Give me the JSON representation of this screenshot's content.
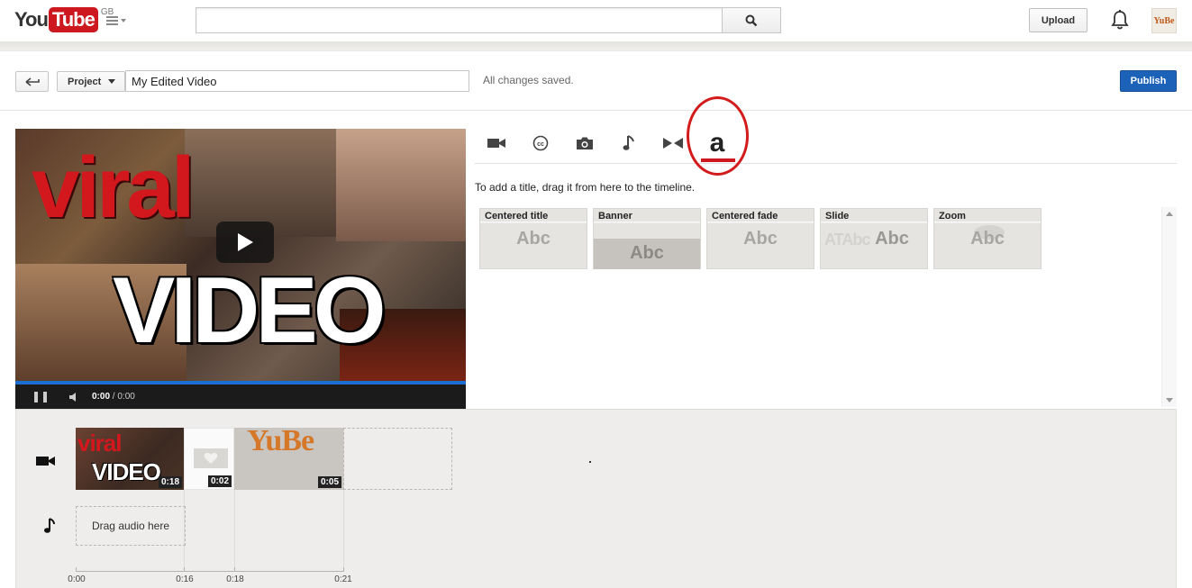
{
  "masthead": {
    "logo_you": "You",
    "logo_tube": "Tube",
    "region": "GB",
    "search_value": "",
    "upload_label": "Upload",
    "avatar_text": "YuBe"
  },
  "project_bar": {
    "project_label": "Project",
    "title_value": "My Edited Video",
    "status": "All changes saved.",
    "publish_label": "Publish"
  },
  "preview": {
    "thumb_line1": "viral",
    "thumb_line2": "VIDEO",
    "current_time": "0:00",
    "separator": " / ",
    "total_time": "0:00"
  },
  "tabs": [
    {
      "id": "clips",
      "icon": "video-camera-icon"
    },
    {
      "id": "captions",
      "icon": "cc-icon"
    },
    {
      "id": "photos",
      "icon": "camera-icon"
    },
    {
      "id": "audio",
      "icon": "music-note-icon"
    },
    {
      "id": "transitions",
      "icon": "bowtie-icon"
    },
    {
      "id": "text",
      "label": "a",
      "active": true
    }
  ],
  "instruction": "To add a title, drag it from here to the timeline.",
  "title_templates": [
    {
      "name": "Centered title",
      "sample": "Abc"
    },
    {
      "name": "Banner",
      "sample": "Abc"
    },
    {
      "name": "Centered fade",
      "sample": "Abc"
    },
    {
      "name": "Slide",
      "sample": "Abc",
      "ghost": "ATAbc"
    },
    {
      "name": "Zoom",
      "sample": "Abc"
    }
  ],
  "timeline": {
    "clips": [
      {
        "label_top": "viral",
        "label_bottom": "VIDEO",
        "duration": "0:18"
      },
      {
        "duration": "0:02"
      },
      {
        "logo": "YuBe",
        "duration": "0:05"
      }
    ],
    "audio_drop_label": "Drag audio here",
    "ruler_labels": [
      "0:00",
      "0:16",
      "0:18",
      "0:21"
    ]
  },
  "colors": {
    "brand_red": "#cc181e",
    "publish_blue": "#1c62b9",
    "highlight_ring": "#d41b1b"
  }
}
